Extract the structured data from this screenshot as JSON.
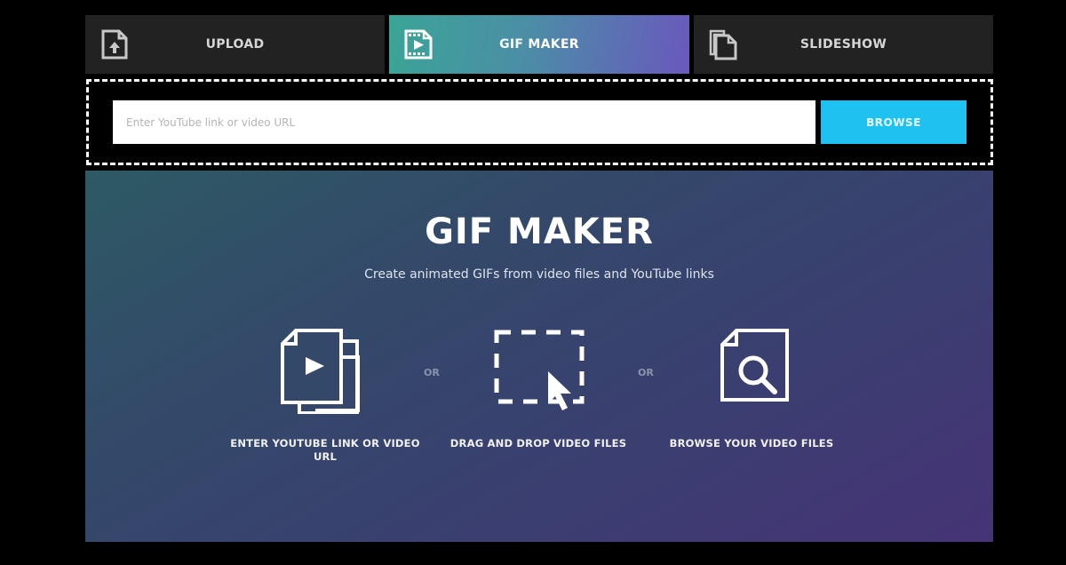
{
  "tabs": [
    {
      "label": "UPLOAD",
      "icon": "file-upload-icon",
      "active": false
    },
    {
      "label": "GIF MAKER",
      "icon": "video-file-icon",
      "active": true
    },
    {
      "label": "SLIDESHOW",
      "icon": "copy-files-icon",
      "active": false
    }
  ],
  "url_bar": {
    "input_value": "",
    "input_placeholder": "Enter YouTube link or video URL",
    "browse_label": "BROWSE"
  },
  "main": {
    "title": "GIF MAKER",
    "subtitle": "Create animated GIFs from video files and YouTube links",
    "options": [
      {
        "label": "ENTER YOUTUBE LINK OR VIDEO URL",
        "icon": "video-files-icon"
      },
      {
        "label": "DRAG AND DROP VIDEO FILES",
        "icon": "drag-drop-cursor-icon"
      },
      {
        "label": "BROWSE YOUR VIDEO FILES",
        "icon": "file-search-icon"
      }
    ],
    "separator": "OR"
  },
  "colors": {
    "browse_button": "#1ec2f0",
    "active_tab_start": "#3aa596",
    "active_tab_end": "#6a58bd",
    "inactive_tab": "#222222"
  }
}
